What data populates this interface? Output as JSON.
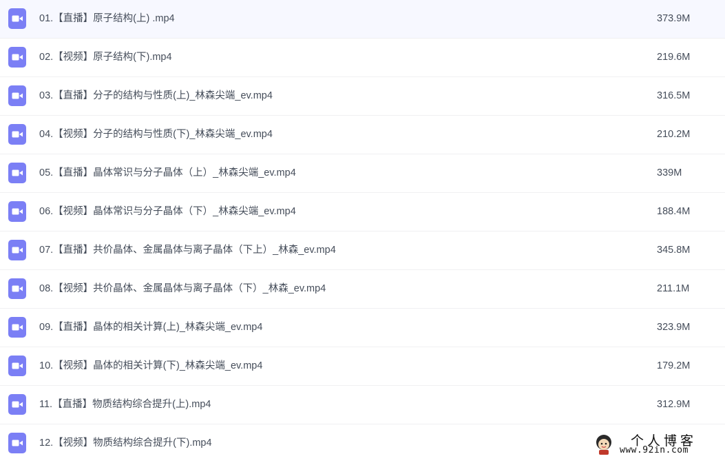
{
  "colors": {
    "icon_bg": "#7b7ff5",
    "icon_fg": "#ffffff",
    "text": "#454d5a",
    "divider": "#f0f0f2"
  },
  "files": [
    {
      "name": "01.【直播】原子结构(上) .mp4",
      "size": "373.9M",
      "icon": "video-file-icon"
    },
    {
      "name": "02.【视频】原子结构(下).mp4",
      "size": "219.6M",
      "icon": "video-file-icon"
    },
    {
      "name": "03.【直播】分子的结构与性质(上)_林森尖端_ev.mp4",
      "size": "316.5M",
      "icon": "video-file-icon"
    },
    {
      "name": "04.【视频】分子的结构与性质(下)_林森尖端_ev.mp4",
      "size": "210.2M",
      "icon": "video-file-icon"
    },
    {
      "name": "05.【直播】晶体常识与分子晶体（上）_林森尖端_ev.mp4",
      "size": "339M",
      "icon": "video-file-icon"
    },
    {
      "name": "06.【视频】晶体常识与分子晶体（下）_林森尖端_ev.mp4",
      "size": "188.4M",
      "icon": "video-file-icon"
    },
    {
      "name": "07.【直播】共价晶体、金属晶体与离子晶体（下上）_林森_ev.mp4",
      "size": "345.8M",
      "icon": "video-file-icon"
    },
    {
      "name": "08.【视频】共价晶体、金属晶体与离子晶体（下）_林森_ev.mp4",
      "size": "211.1M",
      "icon": "video-file-icon"
    },
    {
      "name": "09.【直播】晶体的相关计算(上)_林森尖端_ev.mp4",
      "size": "323.9M",
      "icon": "video-file-icon"
    },
    {
      "name": "10.【视频】晶体的相关计算(下)_林森尖端_ev.mp4",
      "size": "179.2M",
      "icon": "video-file-icon"
    },
    {
      "name": "11.【直播】物质结构综合提升(上).mp4",
      "size": "312.9M",
      "icon": "video-file-icon"
    },
    {
      "name": "12.【视频】物质结构综合提升(下).mp4",
      "size": "",
      "icon": "video-file-icon"
    }
  ],
  "watermark": {
    "title": "个人博客",
    "url": "www.92in.com"
  }
}
